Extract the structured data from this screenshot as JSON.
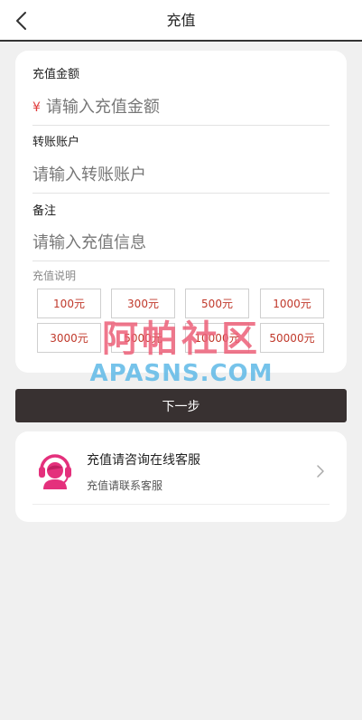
{
  "header": {
    "title": "充值",
    "back_icon": "chevron-left-icon"
  },
  "form": {
    "amount": {
      "label": "充值金额",
      "currency": "¥",
      "placeholder": "请输入充值金额",
      "value": ""
    },
    "account": {
      "label": "转账账户",
      "placeholder": "请输入转账账户",
      "value": ""
    },
    "note": {
      "label": "备注",
      "placeholder": "请输入充值信息",
      "value": ""
    },
    "description_label": "充值说明",
    "quick_amounts": [
      "100元",
      "300元",
      "500元",
      "1000元",
      "3000元",
      "5000元",
      "10000元",
      "50000元"
    ]
  },
  "watermark": {
    "cn": "阿帕社区",
    "en": "APASNS.COM"
  },
  "next_button": {
    "label": "下一步"
  },
  "service": {
    "title": "充值请咨询在线客服",
    "subtitle": "充值请联系客服",
    "icon": "customer-service-headset-icon"
  },
  "colors": {
    "background": "#f0f0f0",
    "card": "#ffffff",
    "button_dark": "#383131",
    "amount_text": "#c0392b",
    "currency": "#e13b3b",
    "service_icon": "#e4307c"
  }
}
